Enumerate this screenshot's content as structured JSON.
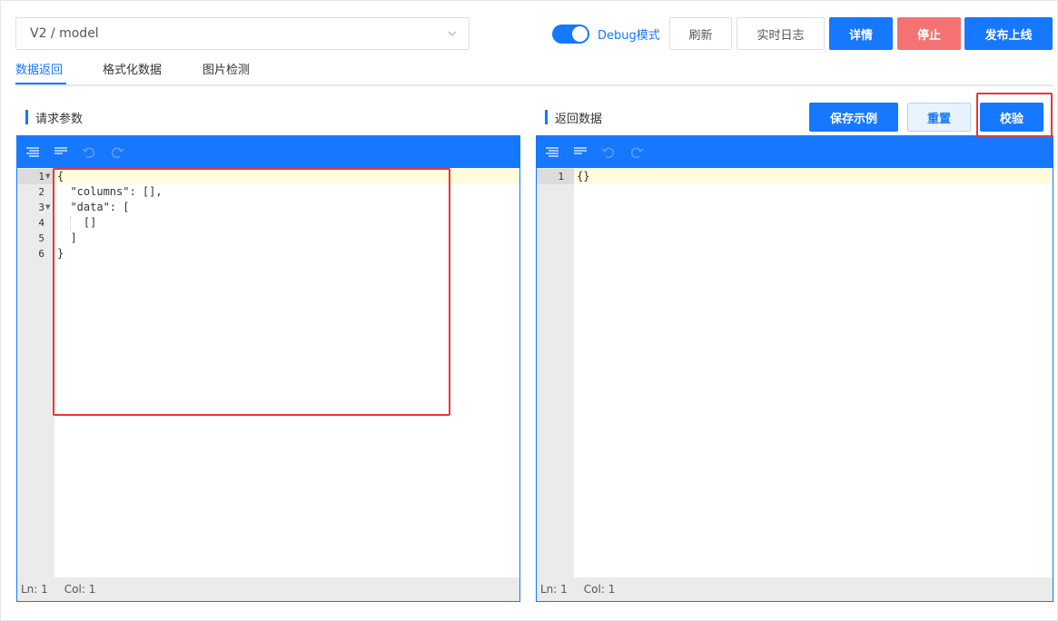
{
  "header": {
    "model_select": {
      "value": "V2 / model"
    },
    "debug_toggle": {
      "label": "Debug模式",
      "on": true
    },
    "buttons": {
      "refresh": "刷新",
      "realtime_log": "实时日志",
      "details": "详情",
      "stop": "停止",
      "publish": "发布上线"
    }
  },
  "tabs": [
    {
      "label": "数据返回",
      "active": true
    },
    {
      "label": "格式化数据",
      "active": false
    },
    {
      "label": "图片检测",
      "active": false
    }
  ],
  "left_panel": {
    "title": "请求参数",
    "line_numbers": [
      "1",
      "2",
      "3",
      "4",
      "5",
      "6"
    ],
    "code_lines": [
      "{",
      "  \"columns\": [],",
      "  \"data\": [",
      "    []",
      "  ]",
      "}"
    ],
    "status": {
      "ln": "Ln: 1",
      "col": "Col: 1"
    }
  },
  "right_panel": {
    "title": "返回数据",
    "buttons": {
      "save_example": "保存示例",
      "reset": "重置",
      "validate": "校验"
    },
    "line_numbers": [
      "1"
    ],
    "code_lines": [
      "{}"
    ],
    "status": {
      "ln": "Ln: 1",
      "col": "Col: 1"
    }
  },
  "colors": {
    "primary": "#1677ff",
    "danger": "#f47272",
    "highlight_box": "#e53935"
  }
}
